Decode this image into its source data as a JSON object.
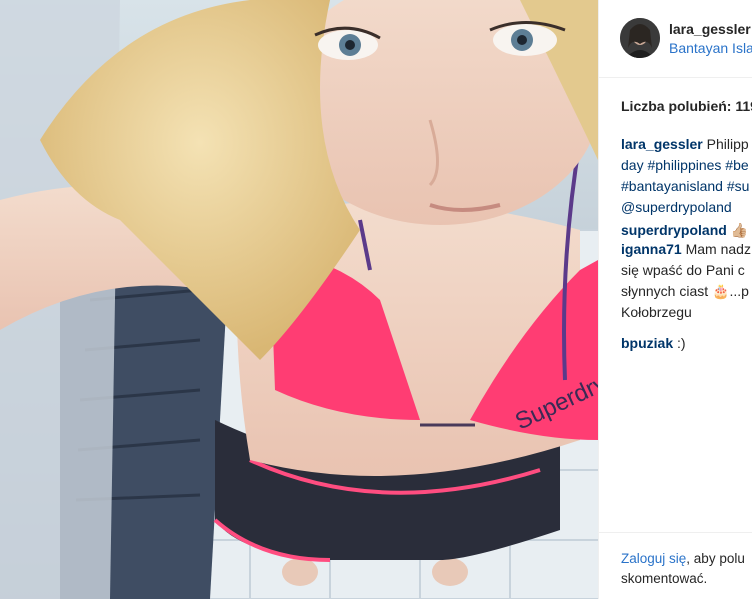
{
  "photo": {
    "description_icon": "selfie-photo",
    "colors": {
      "bikini": "#ff3d73",
      "shorts": "#2a2d3a",
      "skin": "#f2d6c8",
      "hair": "#e9cf9a"
    }
  },
  "post": {
    "username": "lara_gessler",
    "location": "Bantayan Isla",
    "likes": "Liczba polubień: 119"
  },
  "comments": [
    {
      "user": "lara_gessler",
      "lines": [
        "Philipp",
        "day #philippines #be",
        "#bantayanisland #su",
        "@superdrypoland"
      ]
    },
    {
      "user": "superdrypoland",
      "emoji": "👍🏼"
    },
    {
      "user": "iganna71",
      "lines": [
        "Mam nadz",
        "się wpaść do Pani c",
        "słynnych ciast 🎂...p",
        "Kołobrzegu"
      ]
    },
    {
      "user": "bpuziak",
      "text": ":)"
    }
  ],
  "login_prompt": {
    "link": "Zaloguj się",
    "rest_line1": ", aby polu",
    "line2": "skomentować."
  }
}
